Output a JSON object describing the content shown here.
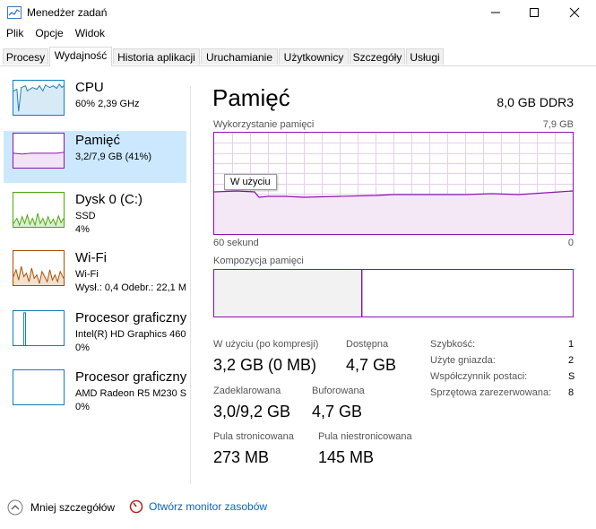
{
  "window": {
    "title": "Menedżer zadań"
  },
  "menu": [
    "Plik",
    "Opcje",
    "Widok"
  ],
  "tabs": [
    "Procesy",
    "Wydajność",
    "Historia aplikacji",
    "Uruchamianie",
    "Użytkownicy",
    "Szczegóły",
    "Usługi"
  ],
  "active_tab": "Wydajność",
  "sidebar": [
    {
      "name": "CPU",
      "line1": "60% 2,39 GHz",
      "line2": ""
    },
    {
      "name": "Pamięć",
      "line1": "3,2/7,9 GB (41%)",
      "line2": ""
    },
    {
      "name": "Dysk 0 (C:)",
      "line1": "SSD",
      "line2": "4%"
    },
    {
      "name": "Wi-Fi",
      "line1": "Wi-Fi",
      "line2": "Wysł.: 0,4 Odebr.: 22,1 M"
    },
    {
      "name": "Procesor graficzny",
      "line1": "Intel(R) HD Graphics 460",
      "line2": "0%"
    },
    {
      "name": "Procesor graficzny",
      "line1": "AMD Radeon R5 M230 S",
      "line2": "0%"
    }
  ],
  "colors": {
    "cpu": "#117dbb",
    "memory": "#8b12ae",
    "disk": "#4da60c",
    "wifi": "#a74f01",
    "gpu": "#117dbb",
    "selected": "#cce8ff"
  },
  "main": {
    "title": "Pamięć",
    "type": "8,0 GB DDR3",
    "usage_label": "Wykorzystanie pamięci",
    "usage_max": "7,9 GB",
    "axis_left": "60 sekund",
    "axis_right": "0",
    "tooltip": "W użyciu",
    "composition_label": "Kompozycja pamięci",
    "in_use_fraction": 0.41
  },
  "stats": {
    "in_use": {
      "label": "W użyciu (po kompresji)",
      "value": "3,2 GB (0 MB)"
    },
    "available": {
      "label": "Dostępna",
      "value": "4,7 GB"
    },
    "committed": {
      "label": "Zadeklarowana",
      "value": "3,0/9,2 GB"
    },
    "cached": {
      "label": "Buforowana",
      "value": "4,7 GB"
    },
    "paged": {
      "label": "Pula stronicowana",
      "value": "273 MB"
    },
    "nonpaged": {
      "label": "Pula niestronicowana",
      "value": "145 MB"
    }
  },
  "details": [
    {
      "label": "Szybkość:",
      "value": "1"
    },
    {
      "label": "Użyte gniazda:",
      "value": "2"
    },
    {
      "label": "Współczynnik postaci:",
      "value": "S"
    },
    {
      "label": "Sprzętowa zarezerwowana:",
      "value": "8"
    }
  ],
  "footer": {
    "fewer_details": "Mniej szczegółów",
    "resource_monitor": "Otwórz monitor zasobów"
  }
}
